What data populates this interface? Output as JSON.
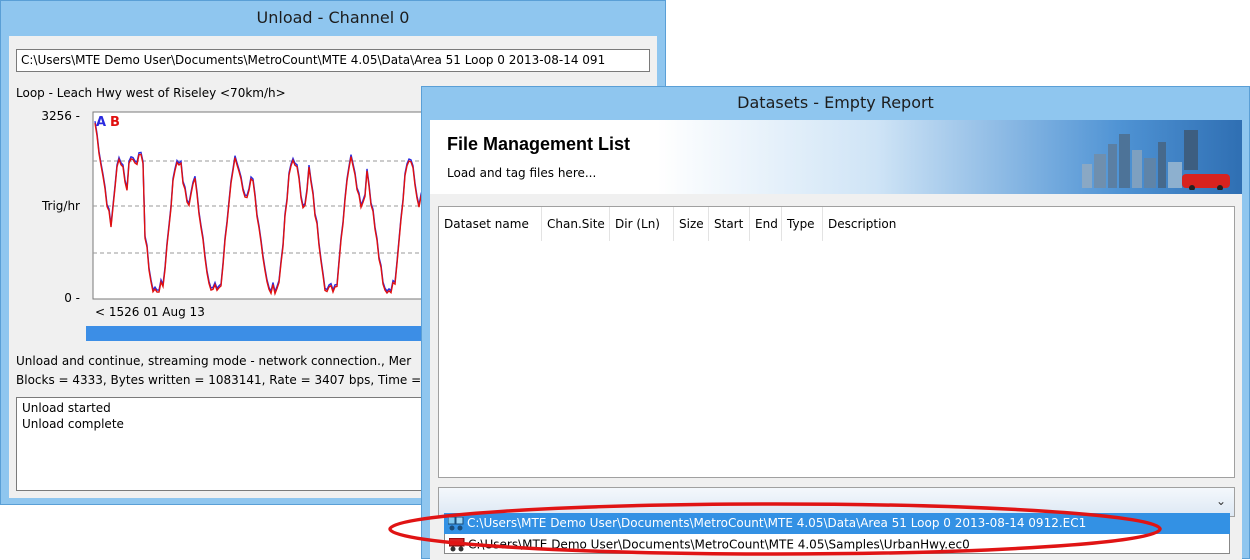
{
  "unload": {
    "title": "Unload - Channel 0",
    "file_path": "C:\\Users\\MTE Demo User\\Documents\\MetroCount\\MTE 4.05\\Data\\Area 51 Loop 0 2013-08-14 091",
    "loop_label": "Loop - Leach Hwy west of Riseley <70km/h>",
    "chart": {
      "y_max_label": "3256 -",
      "y_mid_label": "Trig/hr",
      "y_min_label": "0 -",
      "legend_a": "A",
      "legend_b": "B",
      "x_start_label": "< 1526 01 Aug 13"
    },
    "status_line_1": "Unload and continue, streaming mode - network connection., Mer",
    "status_line_2": "Blocks = 4333, Bytes written = 1083141, Rate = 3407 bps, Time =",
    "log": [
      "Unload started",
      "Unload complete"
    ]
  },
  "datasets": {
    "title": "Datasets - Empty Report",
    "heading": "File Management List",
    "subheading": "Load and tag files here...",
    "columns": [
      "Dataset name",
      "Chan.Site",
      "Dir (Ln)",
      "Size",
      "Start",
      "End",
      "Type",
      "Description"
    ],
    "dropdown_items": [
      "C:\\Users\\MTE Demo User\\Documents\\MetroCount\\MTE 4.05\\Data\\Area 51 Loop 0 2013-08-14 0912.EC1",
      "C:\\Users\\MTE Demo User\\Documents\\MetroCount\\MTE 4.05\\Samples\\UrbanHwy.ec0"
    ]
  },
  "colors": {
    "window_frame": "#8fc6ef",
    "chart_series_a": "#2a2adf",
    "chart_series_b": "#e01010",
    "selection": "#3391e4",
    "annotation": "#e01414"
  }
}
